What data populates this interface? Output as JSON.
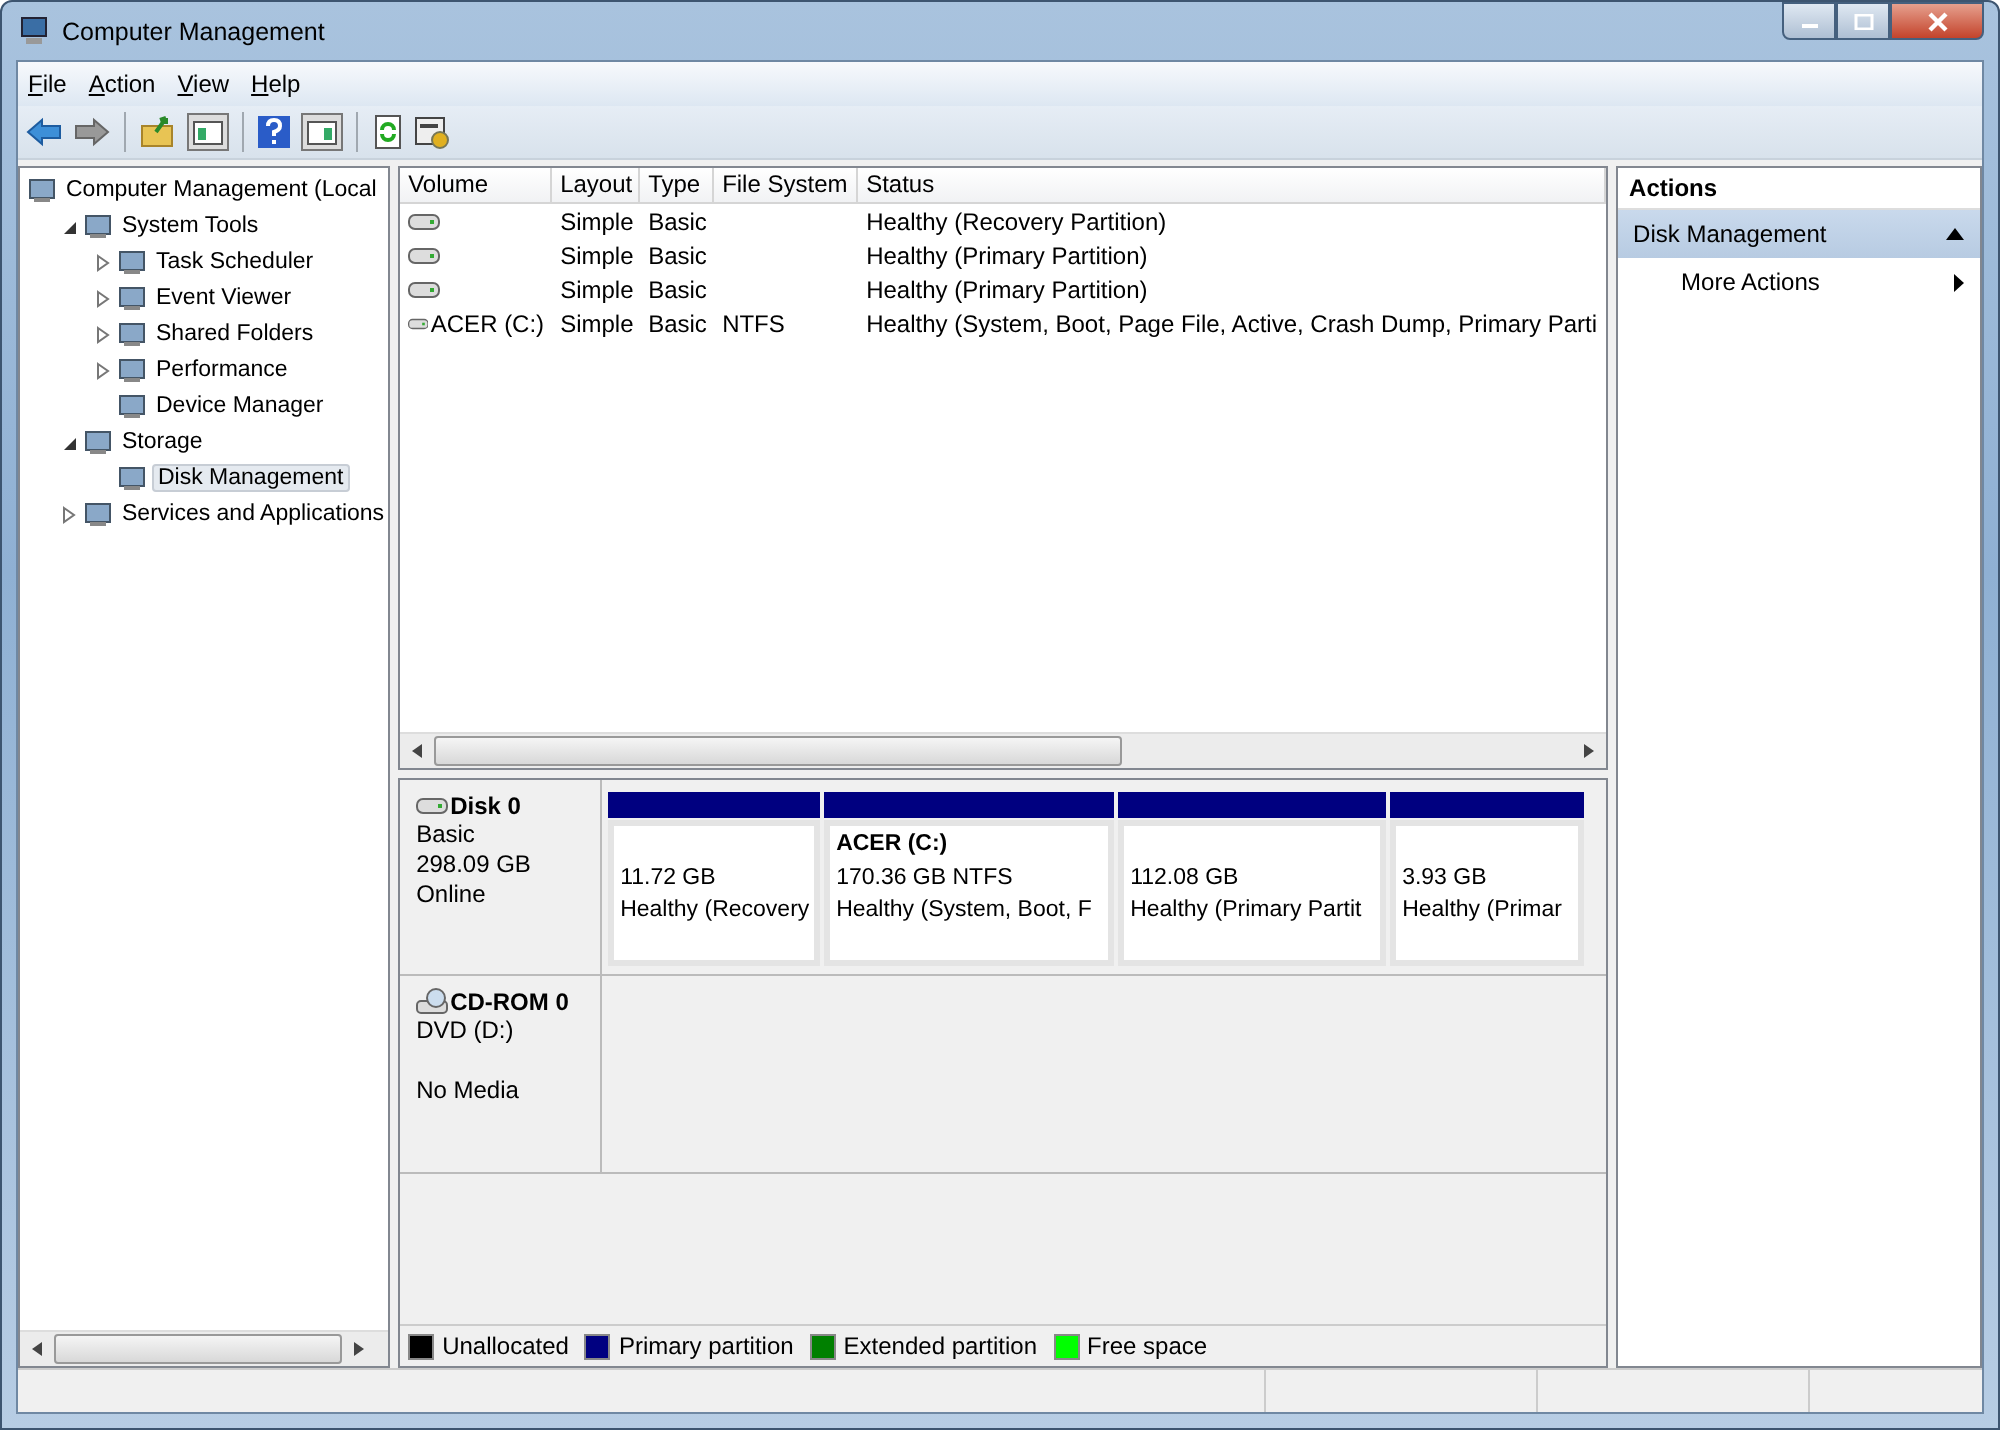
{
  "window": {
    "title": "Computer Management"
  },
  "menu": [
    "File",
    "Action",
    "View",
    "Help"
  ],
  "tree": [
    {
      "label": "Computer Management (Local",
      "selected": false,
      "children": [
        {
          "label": "System Tools",
          "expanded": true,
          "selected": false,
          "children": [
            {
              "label": "Task Scheduler",
              "expanded": false,
              "selected": false
            },
            {
              "label": "Event Viewer",
              "expanded": false,
              "selected": false
            },
            {
              "label": "Shared Folders",
              "expanded": false,
              "selected": false
            },
            {
              "label": "Performance",
              "expanded": false,
              "selected": false
            },
            {
              "label": "Device Manager",
              "selected": false
            }
          ]
        },
        {
          "label": "Storage",
          "expanded": true,
          "selected": false,
          "children": [
            {
              "label": "Disk Management",
              "selected": true
            }
          ]
        },
        {
          "label": "Services and Applications",
          "expanded": false,
          "selected": false
        }
      ]
    }
  ],
  "volumes": {
    "columns": [
      "Volume",
      "Layout",
      "Type",
      "File System",
      "Status"
    ],
    "rows": [
      [
        "",
        "Simple",
        "Basic",
        "",
        "Healthy (Recovery Partition)"
      ],
      [
        "",
        "Simple",
        "Basic",
        "",
        "Healthy (Primary Partition)"
      ],
      [
        "",
        "Simple",
        "Basic",
        "",
        "Healthy (Primary Partition)"
      ],
      [
        "ACER (C:)",
        "Simple",
        "Basic",
        "NTFS",
        "Healthy (System, Boot, Page File, Active, Crash Dump, Primary Parti"
      ]
    ]
  },
  "disks": [
    {
      "kind": "disk",
      "name": "Disk 0",
      "lines": [
        "Basic",
        "298.09 GB",
        "Online"
      ],
      "partitions": [
        {
          "size": "11.72 GB",
          "status": "Healthy (Recovery",
          "color": "#000080"
        },
        {
          "label": "ACER  (C:)",
          "size": "170.36 GB NTFS",
          "status": "Healthy (System, Boot, F",
          "color": "#000080"
        },
        {
          "size": "112.08 GB",
          "status": "Healthy (Primary Partit",
          "color": "#000080"
        },
        {
          "size": "3.93 GB",
          "status": "Healthy (Primar",
          "color": "#000080"
        }
      ]
    },
    {
      "kind": "cdrom",
      "name": "CD-ROM 0",
      "lines": [
        "DVD (D:)",
        "No Media"
      ]
    }
  ],
  "legend": [
    {
      "label": "Unallocated",
      "color": "#000000"
    },
    {
      "label": "Primary partition",
      "color": "#000080"
    },
    {
      "label": "Extended partition",
      "color": "#008000"
    },
    {
      "label": "Free space",
      "color": "#00ff00"
    }
  ],
  "actions": {
    "title": "Actions",
    "section": {
      "label": "Disk Management",
      "expanded": true
    },
    "items": [
      "More Actions"
    ]
  }
}
